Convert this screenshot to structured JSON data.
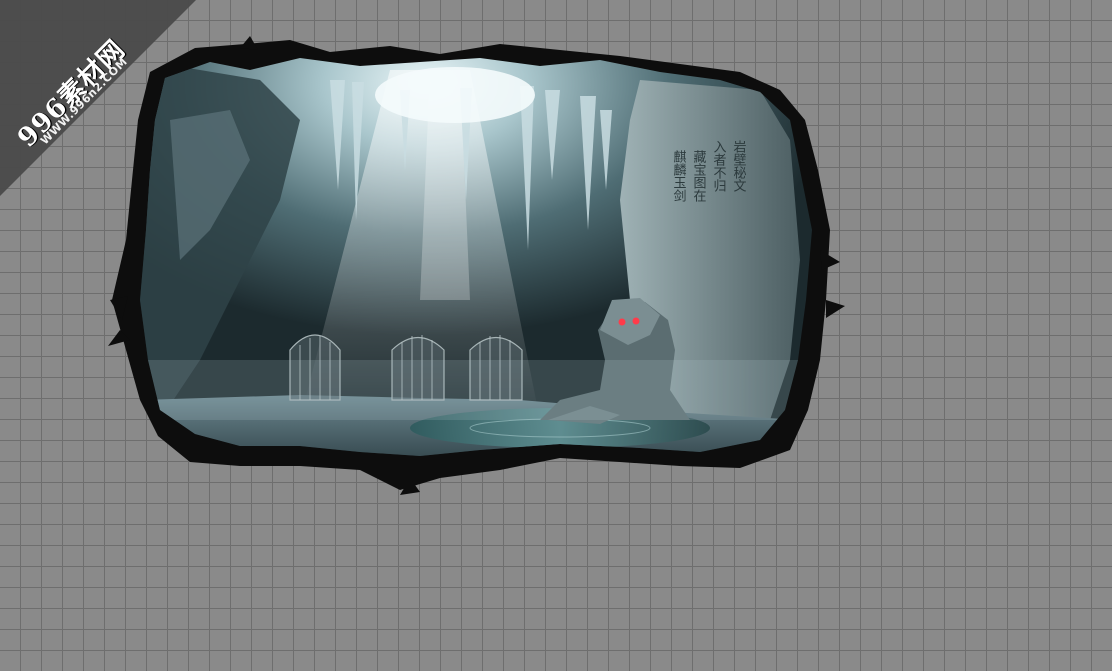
{
  "watermark": {
    "title": "996素材网",
    "url": "WWW.996n2.COM"
  },
  "scene": {
    "description_icon": "cave-scene-image",
    "carved_text_columns": [
      "麒麟玉剑出",
      "藏宝图在此",
      "入者不归",
      "岩壁秘文"
    ]
  },
  "colors": {
    "grid_bg": "#8a8a8a",
    "grid_line": "#6e6e6e",
    "ink_frame": "#0c0c0c",
    "cave_light": "#dfeef3",
    "cave_mid": "#6f8a92",
    "cave_dark": "#22343a",
    "water": "#3e6c70",
    "statue_eye": "#ff3b4a"
  }
}
